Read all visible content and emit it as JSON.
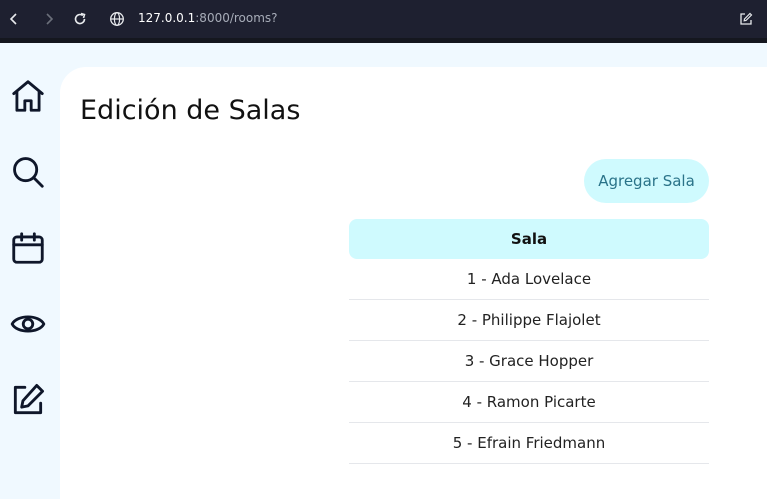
{
  "browser": {
    "url_host": "127.0.0.1",
    "url_rest": ":8000/rooms?",
    "icons": [
      "back-icon",
      "forward-icon",
      "reload-icon",
      "site-info-icon",
      "edit-icon"
    ]
  },
  "sidebar": {
    "items": [
      {
        "icon": "home-icon"
      },
      {
        "icon": "search-icon"
      },
      {
        "icon": "calendar-icon"
      },
      {
        "icon": "eye-icon"
      },
      {
        "icon": "edit-icon"
      }
    ]
  },
  "main": {
    "title": "Edición de Salas",
    "add_button": "Agregar Sala",
    "table": {
      "header": "Sala",
      "rows": [
        "1 - Ada Lovelace",
        "2 - Philippe Flajolet",
        "3 - Grace Hopper",
        "4 - Ramon Picarte",
        "5 - Efrain Friedmann"
      ]
    }
  },
  "colors": {
    "accent_bg": "#cffafe",
    "accent_text": "#2a7389",
    "app_bg": "#f0f9ff"
  }
}
